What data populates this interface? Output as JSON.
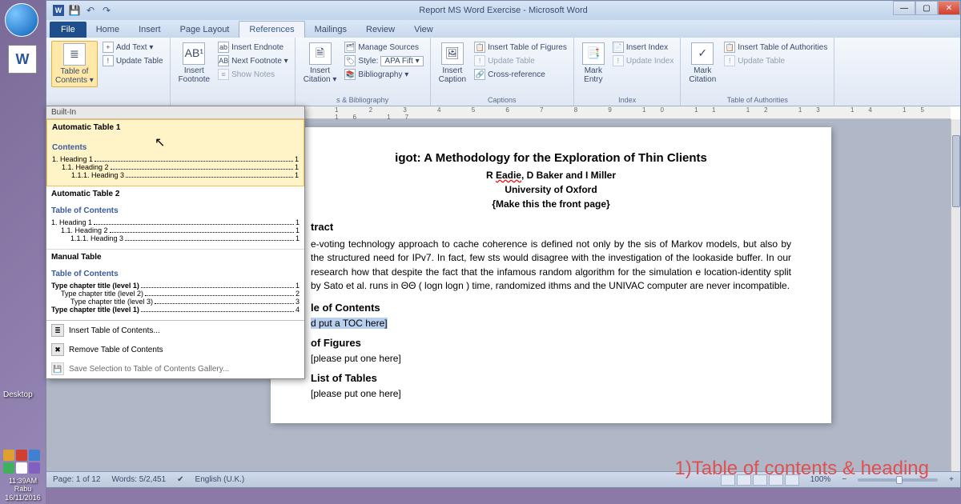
{
  "desktop": {
    "label": "Desktop",
    "clock": {
      "time": "11:39AM",
      "day": "Rabu",
      "date": "16/11/2016"
    }
  },
  "window": {
    "title": "Report MS Word Exercise - Microsoft Word",
    "controls": {
      "min": "—",
      "max": "▢",
      "close": "✕"
    }
  },
  "tabs": {
    "file": "File",
    "home": "Home",
    "insert": "Insert",
    "page_layout": "Page Layout",
    "references": "References",
    "mailings": "Mailings",
    "review": "Review",
    "view": "View"
  },
  "ribbon": {
    "toc": {
      "label": "Table of\nContents ▾",
      "add_text": "Add Text ▾",
      "update": "Update Table",
      "group": ""
    },
    "footnotes": {
      "big": "Insert\nFootnote",
      "endnote": "Insert Endnote",
      "next": "Next Footnote ▾",
      "show": "Show Notes",
      "group": ""
    },
    "citations": {
      "big": "Insert\nCitation ▾",
      "manage": "Manage Sources",
      "style_lbl": "Style:",
      "style_val": "APA Fift ▾",
      "bib": "Bibliography ▾",
      "group": "s & Bibliography"
    },
    "captions": {
      "big": "Insert\nCaption",
      "figs": "Insert Table of Figures",
      "update": "Update Table",
      "cross": "Cross-reference",
      "group": "Captions"
    },
    "index": {
      "big": "Mark\nEntry",
      "insert": "Insert Index",
      "update": "Update Index",
      "group": "Index"
    },
    "auth": {
      "big": "Mark\nCitation",
      "insert": "Insert Table of Authorities",
      "update": "Update Table",
      "group": "Table of Authorities"
    }
  },
  "toc_dropdown": {
    "builtin": "Built-In",
    "auto1": {
      "title": "Automatic Table 1",
      "header": "Contents",
      "lines": [
        {
          "lbl": "1.   Heading 1",
          "pg": "1"
        },
        {
          "lbl": "1.1.   Heading 2",
          "pg": "1"
        },
        {
          "lbl": "1.1.1.   Heading 3",
          "pg": "1"
        }
      ]
    },
    "auto2": {
      "title": "Automatic Table 2",
      "header": "Table of Contents",
      "lines": [
        {
          "lbl": "1.   Heading 1",
          "pg": "1"
        },
        {
          "lbl": "1.1.   Heading 2",
          "pg": "1"
        },
        {
          "lbl": "1.1.1.   Heading 3",
          "pg": "1"
        }
      ]
    },
    "manual": {
      "title": "Manual Table",
      "header": "Table of Contents",
      "lines": [
        {
          "lbl": "Type chapter title (level 1)",
          "pg": "1"
        },
        {
          "lbl": "Type chapter title (level 2)",
          "pg": "2"
        },
        {
          "lbl": "Type chapter title (level 3)",
          "pg": "3"
        },
        {
          "lbl": "Type chapter title (level 1)",
          "pg": "4"
        }
      ]
    },
    "menu": {
      "insert": "Insert Table of Contents...",
      "remove": "Remove Table of Contents",
      "save": "Save Selection to Table of Contents Gallery..."
    }
  },
  "doc": {
    "title_right": "igot: A Methodology for the Exploration of Thin Clients",
    "authors_pre": "R ",
    "authors_underline": "Eadie",
    "authors_post": ", D Baker and I Miller",
    "uni": "University of Oxford",
    "front": "{Make this the front page}",
    "abstract_h": "tract",
    "abstract_body": "e-voting technology approach to cache coherence is defined not only by the sis of Markov models, but also by the structured need for IPv7. In fact, few sts would disagree with the investigation of the lookaside buffer. In our research how that despite the fact that the infamous random algorithm for the simulation e location-identity split by Sato et al. runs in ΘΘ ( logn logn ) time, randomized ithms and the UNIVAC computer are never incompatible.",
    "toc_h": "le of Contents",
    "toc_ph": "d put a TOC here]",
    "lof_h": "of Figures",
    "lof_ph": "[please put one here]",
    "lot_h": "List of Tables",
    "lot_ph": "[please put one here]"
  },
  "ruler": "1 2 3 4 5 6 7 8 9 10 11 12 13 14 15 16 17",
  "status": {
    "page": "Page: 1 of 12",
    "words": "Words: 5/2,451",
    "lang": "English (U.K.)",
    "zoom": "100%"
  },
  "annotation": "1)Table of contents & heading"
}
